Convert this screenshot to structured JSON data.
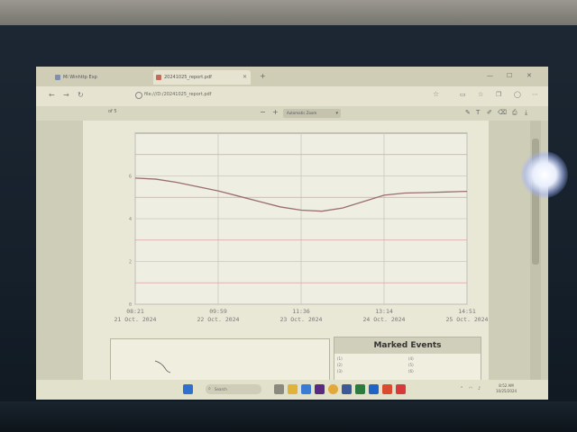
{
  "browser": {
    "tabs": [
      {
        "label": "Mi Winhttp Exp"
      },
      {
        "label": "20241025_report.pdf"
      }
    ],
    "url": "file:///D:/20241025_report.pdf"
  },
  "pdf_toolbar": {
    "page_indicator": "of 5",
    "zoom_label": "Automatic Zoom",
    "zoom_minus": "−",
    "zoom_plus": "+"
  },
  "chart_data": {
    "type": "line",
    "x_ticks": [
      {
        "time": "08:21",
        "date": "21 Oct. 2024"
      },
      {
        "time": "09:59",
        "date": "22 Oct. 2024"
      },
      {
        "time": "11:36",
        "date": "23 Oct. 2024"
      },
      {
        "time": "13:14",
        "date": "24 Oct. 2024"
      },
      {
        "time": "14:51",
        "date": "25 Oct. 2024"
      }
    ],
    "y_ticks": [
      "6",
      "4",
      "2",
      "0"
    ],
    "ylim": [
      0,
      8
    ],
    "grid": true,
    "red_reference_lines": [
      7,
      5,
      3,
      1
    ],
    "series": [
      {
        "color": "#9a6e6e",
        "x": [
          0,
          0.25,
          0.5,
          0.75,
          1.0,
          1.25,
          1.5,
          1.75,
          2.0,
          2.25,
          2.5,
          2.75,
          3.0,
          3.25,
          3.5,
          3.75,
          4.0
        ],
        "values": [
          5.9,
          5.85,
          5.7,
          5.5,
          5.3,
          5.05,
          4.8,
          4.55,
          4.4,
          4.35,
          4.5,
          4.8,
          5.1,
          5.2,
          5.22,
          5.25,
          5.28
        ]
      }
    ]
  },
  "panels": {
    "marked_events_title": "Marked Events",
    "events": [
      "(1)",
      "(2)",
      "(3)",
      "(4)",
      "(5)",
      "(6)"
    ]
  },
  "taskbar": {
    "search_placeholder": "Search",
    "time": "8:52 AM",
    "date": "10/25/2024"
  },
  "colors": {
    "accent_red": "#d9a2a2",
    "grid_gray": "#c8c8c0",
    "plot_bg": "#efeee2"
  }
}
